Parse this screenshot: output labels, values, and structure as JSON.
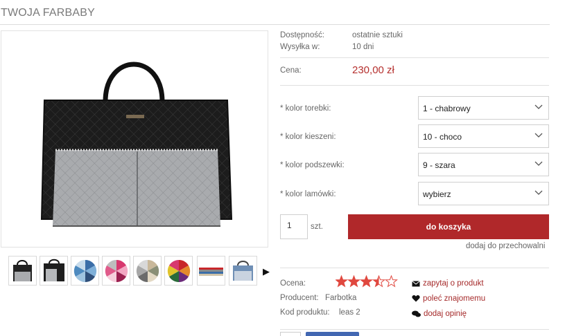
{
  "page": {
    "title": "TWOJA FARBABY"
  },
  "availability": {
    "label": "Dostępność:",
    "value": "ostatnie sztuki",
    "shipping_label": "Wysyłka w:",
    "shipping_value": "10 dni"
  },
  "price": {
    "label": "Cena:",
    "value": "230,00 zł"
  },
  "options": [
    {
      "label": "* kolor torebki:",
      "value": "1 - chabrowy"
    },
    {
      "label": "* kolor kieszeni:",
      "value": "10 - choco"
    },
    {
      "label": "* kolor podszewki:",
      "value": "9 - szara"
    },
    {
      "label": "* kolor lamówki:",
      "value": "wybierz"
    }
  ],
  "cart": {
    "quantity": "1",
    "unit": "szt.",
    "add_button": "do koszyka",
    "wishlist_link": "dodaj do przechowalni"
  },
  "rating": {
    "label": "Ocena:",
    "stars": 3.5,
    "max": 5,
    "color": "#e0483f"
  },
  "producer": {
    "label": "Producent:",
    "value": "Farbotka"
  },
  "product_code": {
    "label": "Kod produktu:",
    "value": "leas 2"
  },
  "actions": {
    "ask": "zapytaj o produkt",
    "recommend": "poleć znajomemu",
    "review": "dodaj opinię"
  },
  "thumbnails": [
    {
      "name": "bag-black-grey"
    },
    {
      "name": "bag-open"
    },
    {
      "name": "color-swatches-blue"
    },
    {
      "name": "color-swatches-pink"
    },
    {
      "name": "color-swatches-beige"
    },
    {
      "name": "color-swatches-multi"
    },
    {
      "name": "color-strips"
    },
    {
      "name": "bag-blue"
    }
  ],
  "colors": {
    "accent": "#b0282a",
    "price": "#b5302e",
    "link": "#a52a2a"
  }
}
